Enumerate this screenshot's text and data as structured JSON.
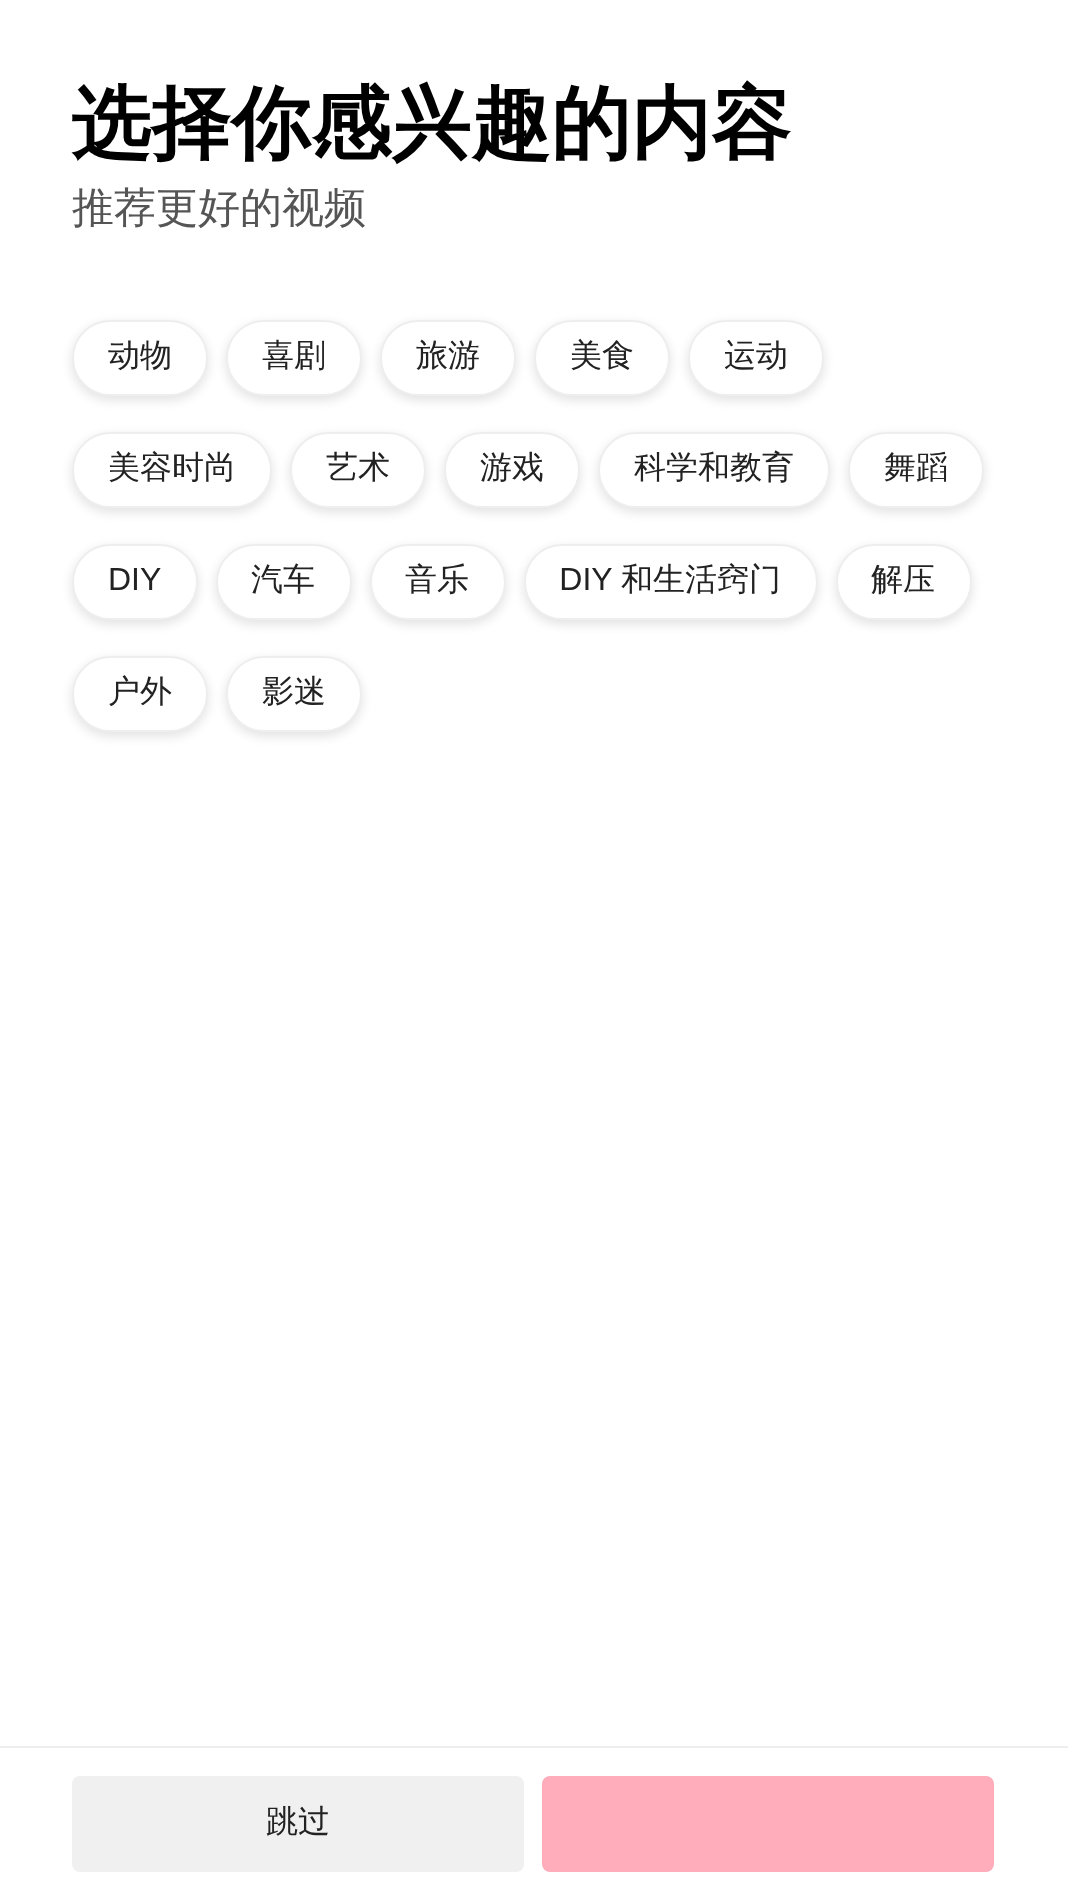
{
  "title": "选择你感兴趣的内容",
  "subtitle": "推荐更好的视频",
  "tags": [
    {
      "label": "动物",
      "selected": false
    },
    {
      "label": "喜剧",
      "selected": false
    },
    {
      "label": "旅游",
      "selected": false
    },
    {
      "label": "美食",
      "selected": false
    },
    {
      "label": "运动",
      "selected": false
    },
    {
      "label": "美容时尚",
      "selected": false
    },
    {
      "label": "艺术",
      "selected": false
    },
    {
      "label": "游戏",
      "selected": false
    },
    {
      "label": "科学和教育",
      "selected": false
    },
    {
      "label": "舞蹈",
      "selected": false
    },
    {
      "label": "DIY",
      "selected": false
    },
    {
      "label": "汽车",
      "selected": false
    },
    {
      "label": "音乐",
      "selected": false
    },
    {
      "label": "DIY 和生活窍门",
      "selected": false
    },
    {
      "label": "解压",
      "selected": false
    },
    {
      "label": "户外",
      "selected": false
    },
    {
      "label": "影迷",
      "selected": false
    }
  ],
  "buttons": [
    {
      "label": "跳过",
      "kind": "secondary"
    },
    {
      "kind": "primary"
    }
  ]
}
